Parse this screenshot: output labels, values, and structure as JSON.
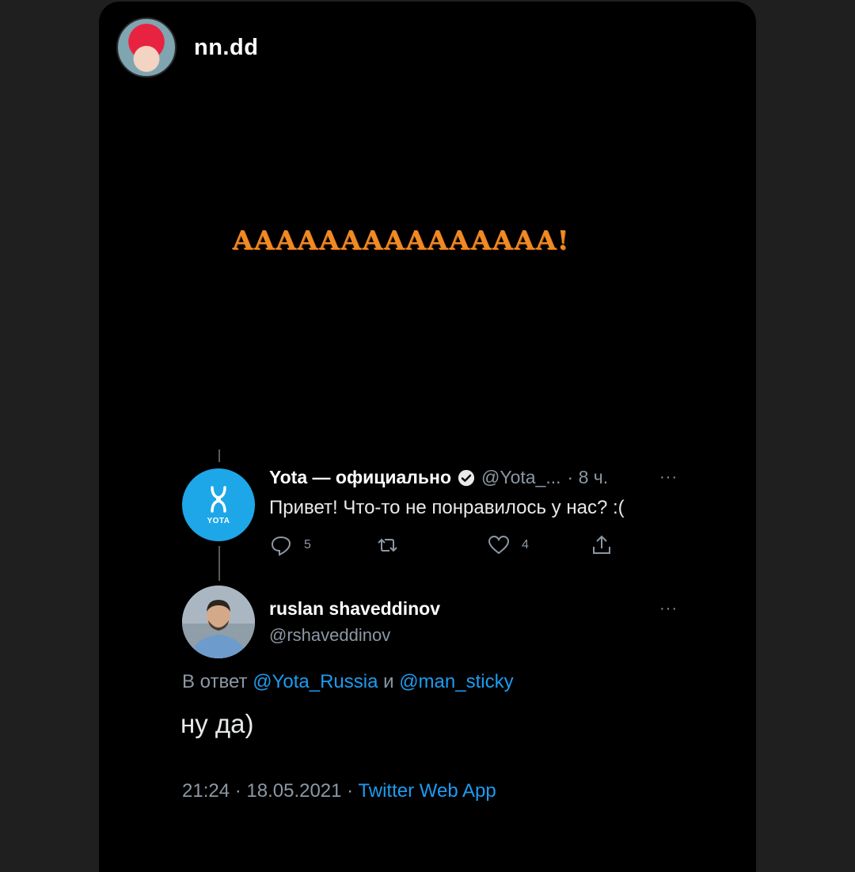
{
  "story": {
    "username": "nn.dd",
    "caption": "ААААААААААААААА!"
  },
  "tweet_parent": {
    "display_name": "Yota — официально",
    "handle": "@Yota_...",
    "time": "· 8 ч.",
    "text": "Привет! Что-то не понравилось у нас? :(",
    "avatar_label": "YOTA",
    "replies": "5",
    "likes": "4",
    "more": "···"
  },
  "tweet_main": {
    "display_name": "ruslan shaveddinov",
    "handle": "@rshaveddinov",
    "reply_prefix": "В ответ",
    "reply_user1": "@Yota_Russia",
    "reply_and": "и",
    "reply_user2": "@man_sticky",
    "text": "ну да)",
    "timestamp": "21:24 · 18.05.2021 ·",
    "source": "Twitter Web App",
    "more": "···"
  },
  "colors": {
    "story_background": "#000000",
    "caption": "#f08a24",
    "link": "#1d9bf0",
    "yota_brand": "#1da7e8",
    "muted_text": "#8b98a5"
  }
}
